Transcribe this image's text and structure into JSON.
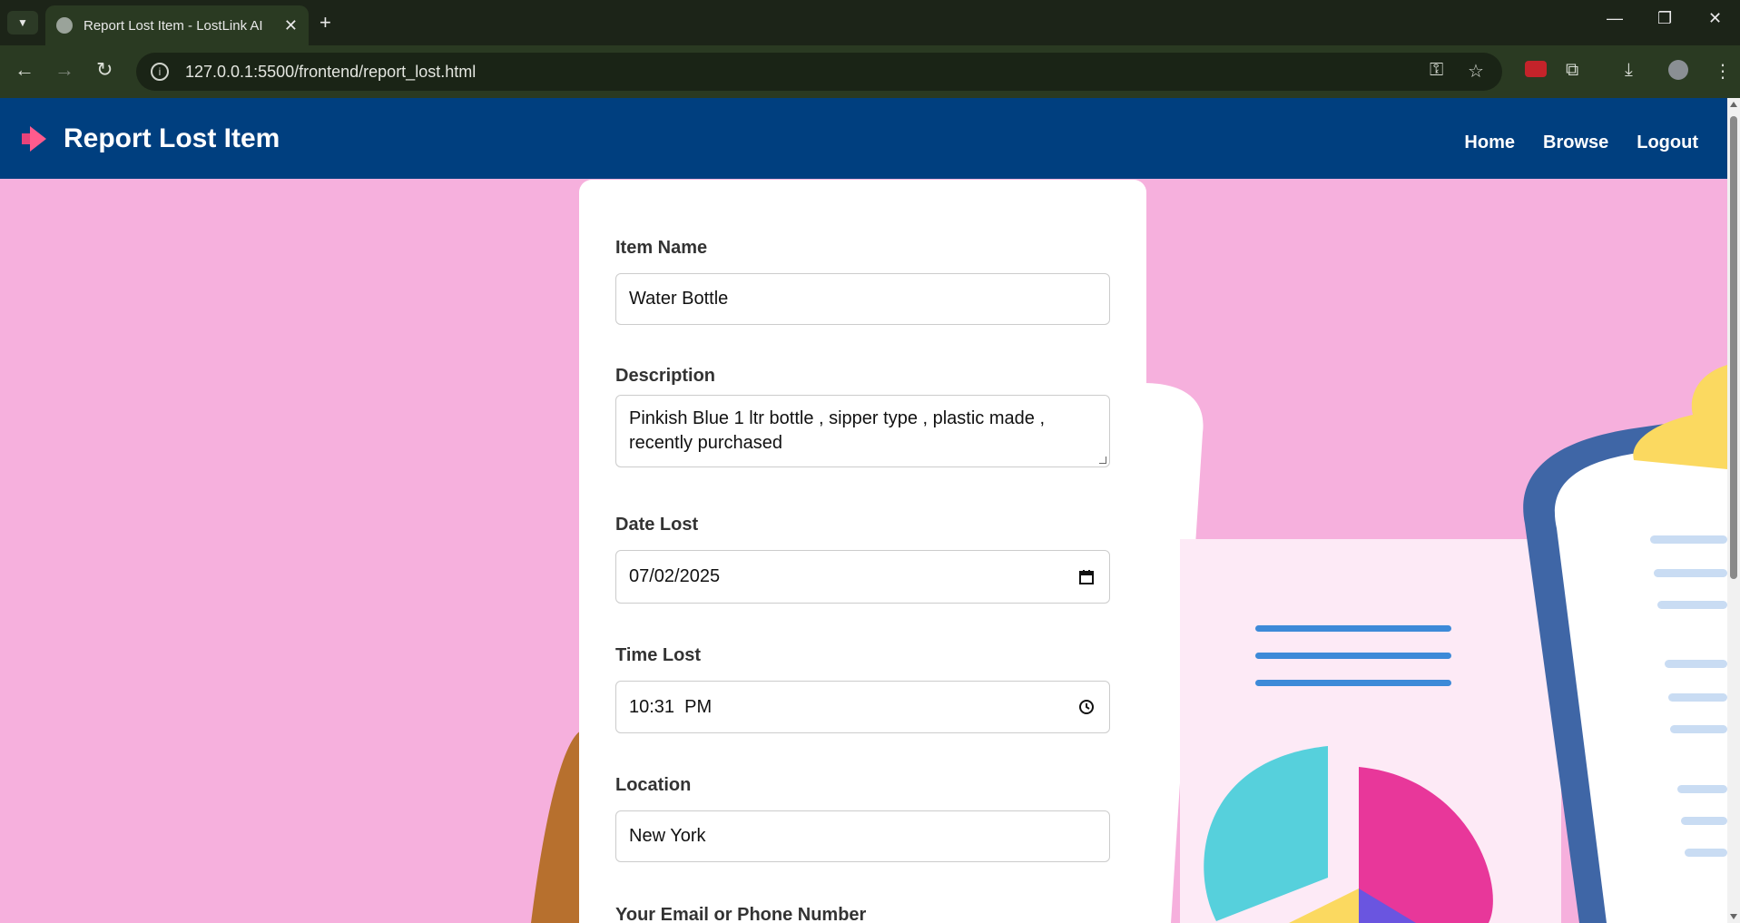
{
  "browser": {
    "tab_title": "Report Lost Item - LostLink AI",
    "url": "127.0.0.1:5500/frontend/report_lost.html",
    "new_tab_symbol": "+",
    "tab_close_symbol": "✕"
  },
  "header": {
    "title": "Report Lost Item",
    "nav": [
      "Home",
      "Browse",
      "Logout"
    ],
    "background": "#003f7f"
  },
  "form": {
    "item_name_label": "Item Name",
    "item_name_value": "Water Bottle",
    "description_label": "Description",
    "description_value": "Pinkish Blue 1 ltr bottle , sipper type , plastic made , recently purchased",
    "date_label": "Date Lost",
    "date_value": "07/02/2025",
    "time_label": "Time Lost",
    "time_value": "10:31  PM",
    "location_label": "Location",
    "location_value": "New York",
    "contact_label": "Your Email or Phone Number"
  },
  "colors": {
    "page_background": "#f6b0dd",
    "accent_pink": "#e8379a",
    "accent_cyan": "#56d0dc",
    "accent_yellow": "#fbd960",
    "accent_blue": "#3f66a6"
  }
}
